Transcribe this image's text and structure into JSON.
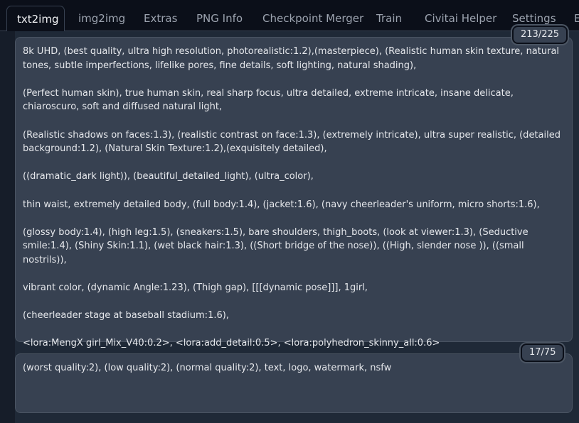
{
  "tabs": [
    {
      "label": "txt2img",
      "active": true
    },
    {
      "label": "img2img"
    },
    {
      "label": "Extras"
    },
    {
      "label": "PNG Info"
    },
    {
      "label": "Checkpoint Merger"
    },
    {
      "label": "Train"
    },
    {
      "label": "Civitai Helper"
    },
    {
      "label": "Settings"
    },
    {
      "label": "E"
    }
  ],
  "prompt": {
    "token_count": "213/225",
    "text": "8k UHD, (best quality, ultra high resolution, photorealistic:1.2),(masterpiece), (Realistic human skin texture, natural tones, subtle imperfections, lifelike pores, fine details, soft lighting, natural shading),\n\n(Perfect human skin), true human skin, real sharp focus, ultra detailed, extreme intricate, insane delicate, chiaroscuro, soft and diffused natural light,\n\n(Realistic shadows on faces:1.3), (realistic contrast on face:1.3), (extremely intricate), ultra super realistic, (detailed background:1.2), (Natural Skin Texture:1.2),(exquisitely detailed),\n\n((dramatic_dark light)), (beautiful_detailed_light), (ultra_color),\n\nthin waist, extremely detailed body, (full body:1.4), (jacket:1.6), (navy cheerleader's uniform, micro shorts:1.6),\n\n(glossy body:1.4), (high leg:1.5), (sneakers:1.5), bare shoulders, thigh_boots, (look at viewer:1.3), (Seductive smile:1.4), (Shiny Skin:1.1), (wet black hair:1.3), ((Short bridge of the nose)), ((High, slender nose )), ((small nostrils)),\n\nvibrant color, (dynamic Angle:1.23), (Thigh gap), [[[dynamic pose]]], 1girl,\n\n(cheerleader stage at baseball stadium:1.6),\n\n<lora:MengX girl_Mix_V40:0.2>, <lora:add_detail:0.5>, <lora:polyhedron_skinny_all:0.6>"
  },
  "negative_prompt": {
    "token_count": "17/75",
    "text": "(worst quality:2), (low quality:2), (normal quality:2), text, logo, watermark, nsfw"
  },
  "colors": {
    "background": "#0b0f19",
    "panel": "#1f2937",
    "textbox": "#374151",
    "text": "#e5e7eb",
    "tab_inactive_text": "#9ca3af"
  }
}
